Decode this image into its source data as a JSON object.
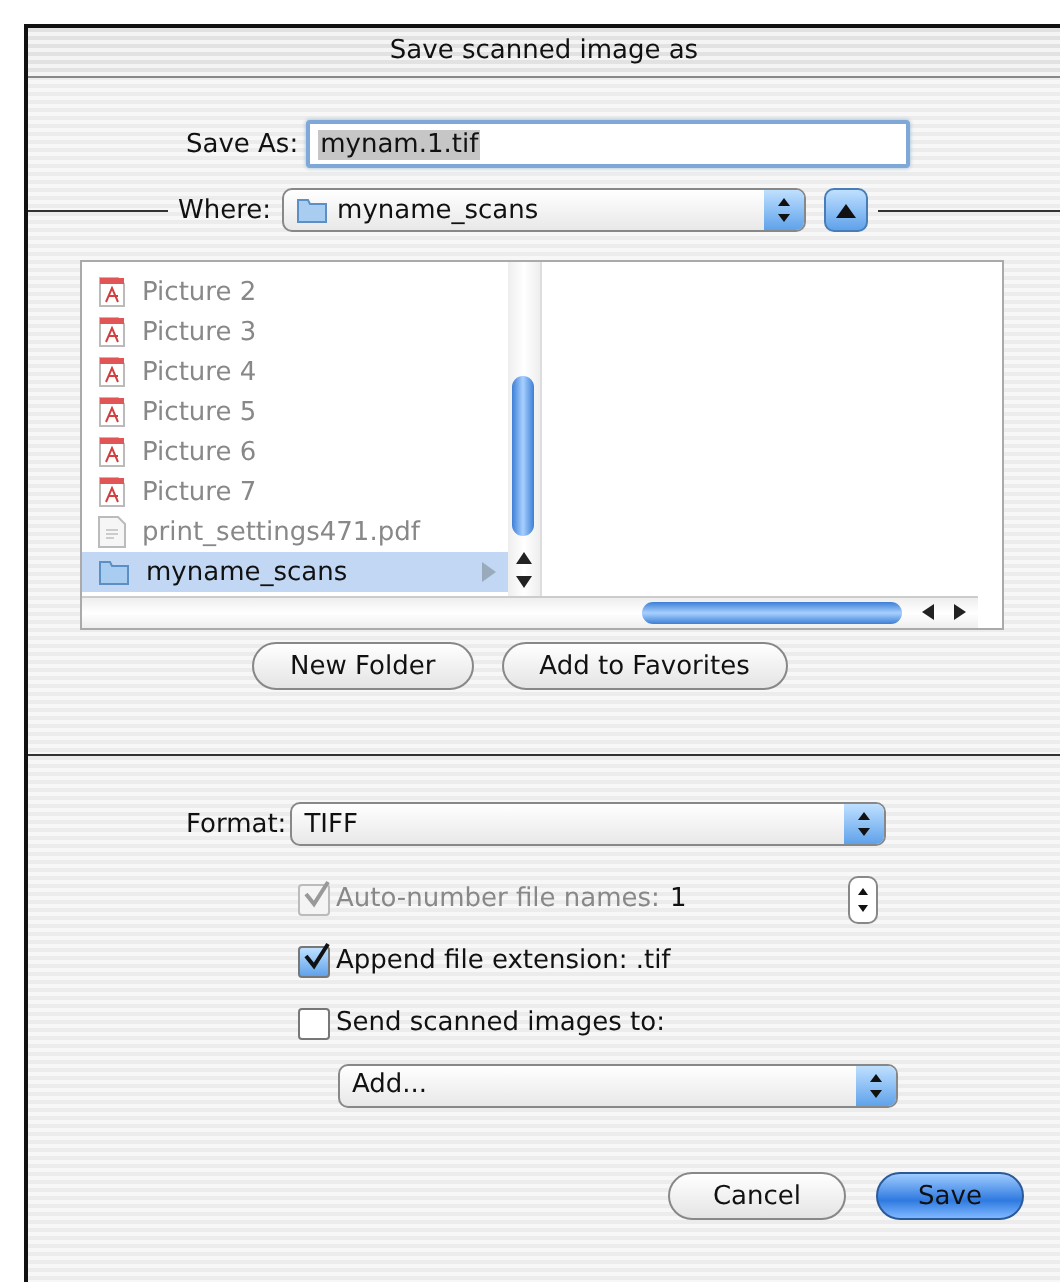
{
  "window": {
    "title": "Save scanned image as"
  },
  "save_as": {
    "label": "Save As:",
    "value": "mynam.1.tif"
  },
  "where": {
    "label": "Where:",
    "value": "myname_scans"
  },
  "browser": {
    "items": [
      {
        "name": "Picture 2",
        "kind": "pdf",
        "disabled": true,
        "selected": false
      },
      {
        "name": "Picture 3",
        "kind": "pdf",
        "disabled": true,
        "selected": false
      },
      {
        "name": "Picture 4",
        "kind": "pdf",
        "disabled": true,
        "selected": false
      },
      {
        "name": "Picture 5",
        "kind": "pdf",
        "disabled": true,
        "selected": false
      },
      {
        "name": "Picture 6",
        "kind": "pdf",
        "disabled": true,
        "selected": false
      },
      {
        "name": "Picture 7",
        "kind": "pdf",
        "disabled": true,
        "selected": false
      },
      {
        "name": "print_settings471.pdf",
        "kind": "doc",
        "disabled": true,
        "selected": false
      },
      {
        "name": "myname_scans",
        "kind": "folder",
        "disabled": false,
        "selected": true
      }
    ]
  },
  "browser_buttons": [
    "New Folder",
    "Add to Favorites"
  ],
  "format": {
    "label": "Format:",
    "value": "TIFF"
  },
  "options": [
    {
      "kind": "stepper",
      "label": "Auto-number file names:",
      "value": "1",
      "checked": true,
      "disabled": true
    },
    {
      "kind": "check",
      "label": "Append file extension: .tif",
      "checked": true,
      "disabled": false
    },
    {
      "kind": "check",
      "label": "Send scanned images to:",
      "checked": false,
      "disabled": false
    },
    {
      "kind": "popup",
      "value": "Add..."
    }
  ],
  "buttons": [
    {
      "label": "Cancel",
      "default": false
    },
    {
      "label": "Save",
      "default": true
    }
  ]
}
